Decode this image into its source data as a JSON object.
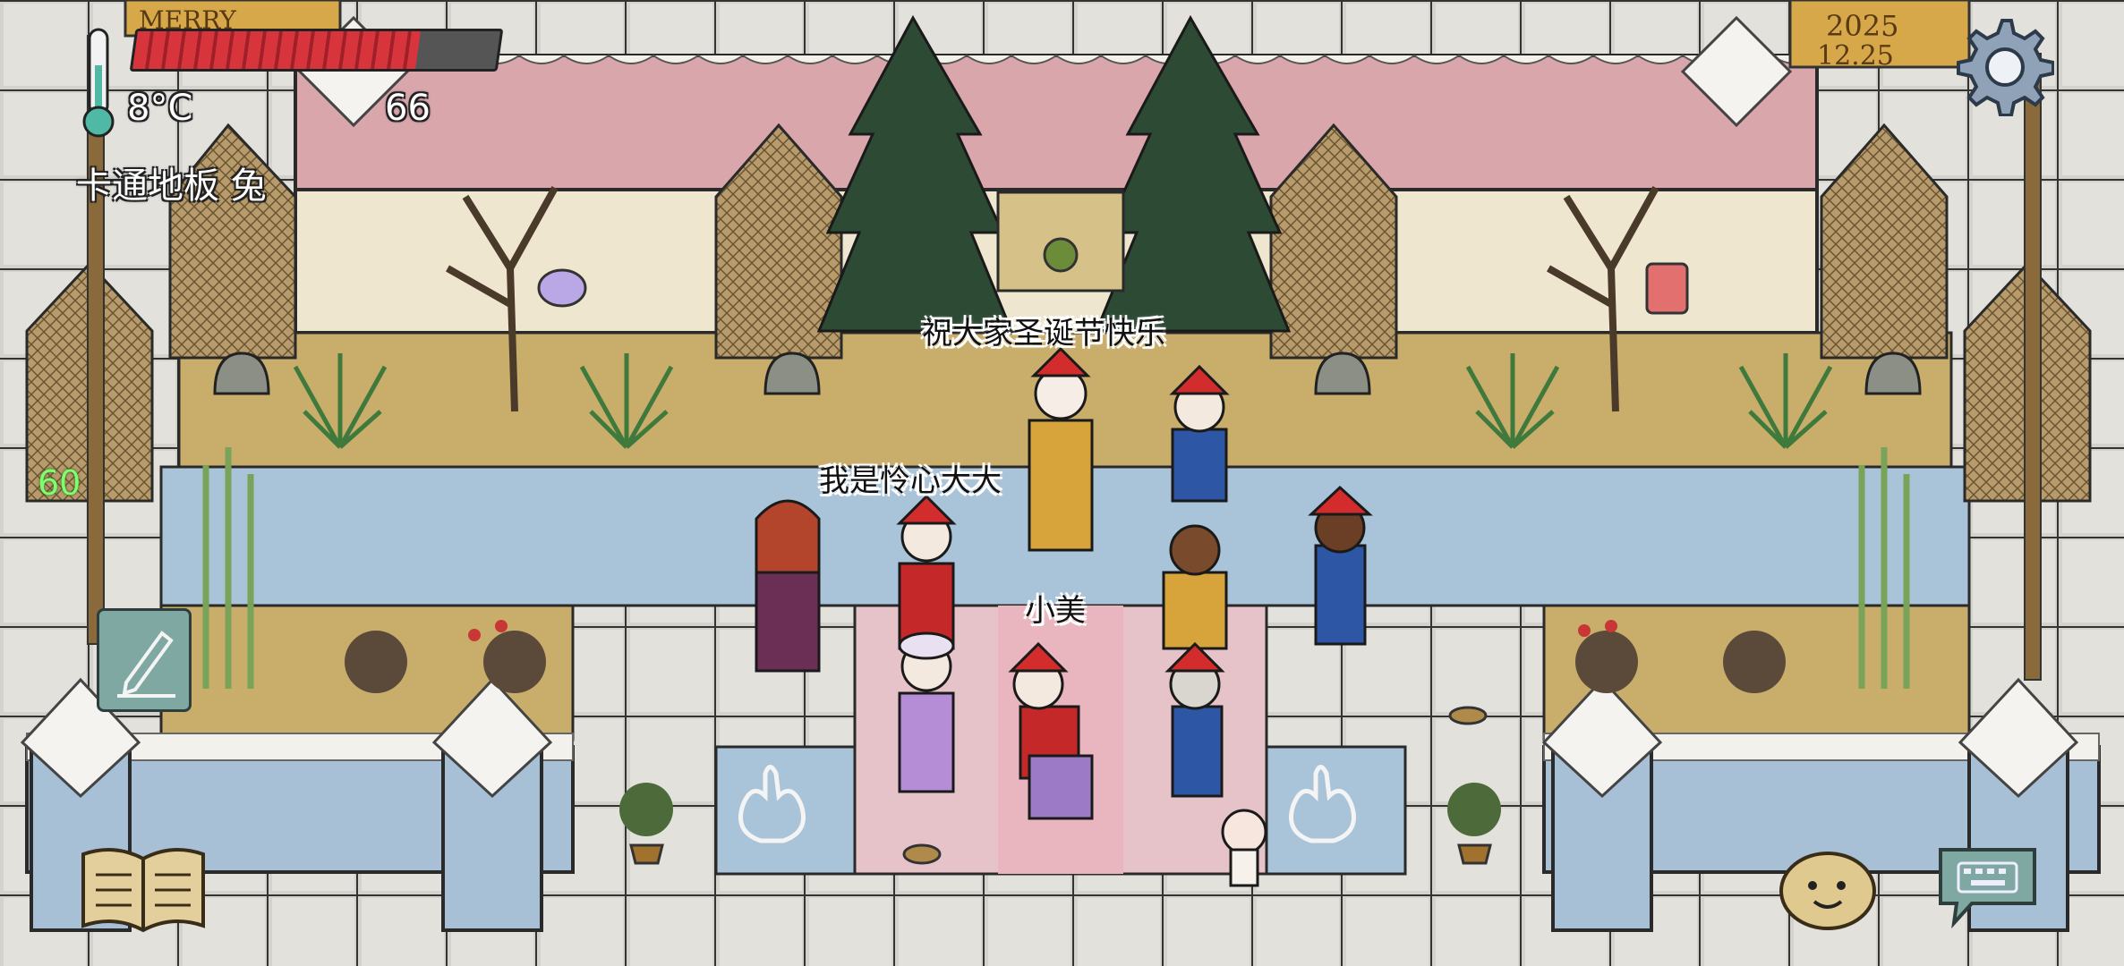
{
  "hud": {
    "temperature": "8°C",
    "food_value": "66",
    "hunger_fraction": 0.78,
    "tile_label": "卡通地板 兔",
    "fps": "60"
  },
  "banners": {
    "left_sign": "MERRY",
    "right_sign_year": "2025",
    "right_sign_date": "12.25"
  },
  "speech": {
    "greeting": "祝大家圣诞节快乐",
    "intro": "我是怜心大大",
    "name_tag": "小美"
  },
  "icons": {
    "thermometer": "thermometer-icon",
    "settings": "gear-icon",
    "edit": "pencil-icon",
    "book": "open-book-icon",
    "emote": "potato-face-icon",
    "keyboard": "keyboard-chat-icon"
  },
  "colors": {
    "hunger_fill": "#d8343b",
    "hunger_empty": "#555555",
    "wall_pink": "#d9a6ac",
    "wall_cream": "#efe6cf",
    "floor_blue": "#a9c3d8",
    "floor_pink": "#e6c3c8",
    "ground_tan": "#c9ad6b",
    "grid_stone": "#cfcdc8"
  }
}
